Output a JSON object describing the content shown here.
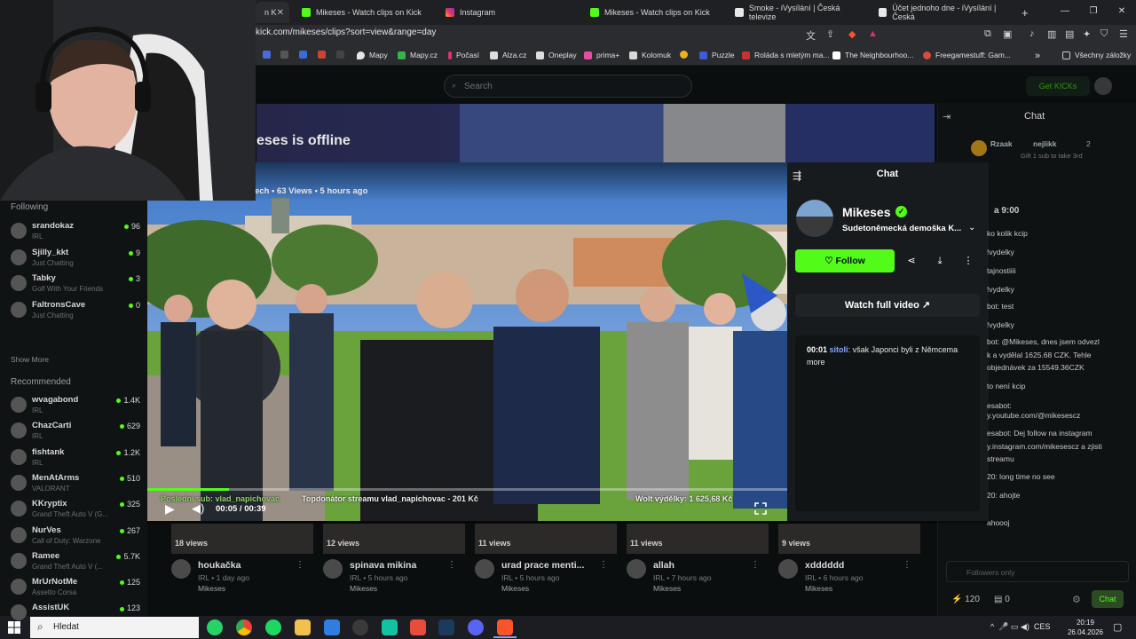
{
  "browser": {
    "tabs": [
      {
        "label": "n K",
        "active": true
      },
      {
        "label": "Mikeses - Watch clips on Kick"
      },
      {
        "label": "Instagram"
      },
      {
        "label": "Mikeses - Watch clips on Kick"
      },
      {
        "label": "Smoke - iVysílání | Česká televize"
      },
      {
        "label": "Účet jednoho dne - iVysílání | Česká"
      }
    ],
    "new_tab": "+",
    "url": "kick.com/mikeses/clips?sort=view&range=day",
    "bookmarks": [
      "Mapy",
      "Mapy.cz",
      "Počasí",
      "Alza.cz",
      "Oneplay",
      "prima+",
      "Kolomuk",
      "Puzzle",
      "Roláda s mletým ma...",
      "The Neighbourhoo...",
      "Freegamestuff: Gam...",
      "Všechny záložky"
    ],
    "bookmarks_more": "»"
  },
  "kick": {
    "search_placeholder": "Search",
    "get_kicks": "Get KICKs",
    "offline_text": "eses is offline",
    "sidebar": {
      "following_heading": "Following",
      "following": [
        {
          "name": "srandokaz",
          "category": "IRL",
          "viewers": "96"
        },
        {
          "name": "Sjilly_kkt",
          "category": "Just Chatting",
          "viewers": "9"
        },
        {
          "name": "Tabky",
          "category": "Golf With Your Friends",
          "viewers": "3"
        },
        {
          "name": "FaltronsCave",
          "category": "Just Chatting",
          "viewers": "0"
        }
      ],
      "show_more": "Show More",
      "recommended_heading": "Recommended",
      "recommended": [
        {
          "name": "wvagabond",
          "category": "IRL",
          "viewers": "1.4K"
        },
        {
          "name": "ChazCarti",
          "category": "IRL",
          "viewers": "629"
        },
        {
          "name": "fishtank",
          "category": "IRL",
          "viewers": "1.2K"
        },
        {
          "name": "MenAtArms",
          "category": "VALORANT",
          "viewers": "510"
        },
        {
          "name": "KKryptix",
          "category": "Grand Theft Auto V (G...",
          "viewers": "325"
        },
        {
          "name": "NurVes",
          "category": "Call of Duty: Warzone",
          "viewers": "267"
        },
        {
          "name": "Ramee",
          "category": "Grand Theft Auto V (...",
          "viewers": "5.7K"
        },
        {
          "name": "MrUrNotMe",
          "category": "Assetto Corsa",
          "viewers": "125"
        },
        {
          "name": "AssistUK",
          "category": "",
          "viewers": "123"
        }
      ]
    },
    "side_chat": {
      "title": "Chat",
      "pinned_user": "Rzaak",
      "pinned_other": "nejlikk",
      "pinned_count": "2",
      "pinned_note": "Gift 1 sub to take 3rd",
      "time_label": "a 9:00",
      "lines": [
        "ko kolik kcip",
        "!vydelky",
        "tajnostiiii",
        "!vydelky",
        "bot: test",
        "!vydelky",
        "bot: @Mikeses, dnes jsem odvezl",
        "k a vydělal 1625.68 CZK. Tehle",
        "objednávek za 15549.36CZK",
        "to není kcip",
        "esabot:",
        "y.youtube.com/@mikesescz",
        "esabot: Dej follow na instagram",
        "y.instagram.com/mikesescz a zjisti",
        "streamu",
        "20: long time no see",
        "20: ahojte",
        "ahoooj"
      ],
      "input_placeholder": "Followers only",
      "kicks_count": "120",
      "slots_count": "0",
      "send_label": "Chat"
    },
    "clips": [
      {
        "views": "18 views",
        "title": "houkačka",
        "meta": "IRL • 1 day ago",
        "channel": "Mikeses"
      },
      {
        "views": "12 views",
        "title": "spinava mikina",
        "meta": "IRL • 5 hours ago",
        "channel": "Mikeses"
      },
      {
        "views": "11 views",
        "title": "urad prace menti...",
        "meta": "IRL • 5 hours ago",
        "channel": "Mikeses"
      },
      {
        "views": "11 views",
        "title": "allah",
        "meta": "IRL • 7 hours ago",
        "channel": "Mikeses"
      },
      {
        "views": "9 views",
        "title": "xdddddd",
        "meta": "IRL • 6 hours ago",
        "channel": "Mikeses"
      }
    ]
  },
  "modal": {
    "video_meta": "ech • 63 Views • 5 hours ago",
    "overlay_left": "Poslední sub: vlad_napichovac",
    "overlay_mid": "Topdonátor streamu vlad_napichovac - 201 Kč",
    "overlay_right": "Wolt výdělky: 1 625,68 Kč",
    "time": "00:05 / 00:39",
    "progress_fraction": 0.128,
    "panel_title": "Chat",
    "channel_name": "Mikeses",
    "clip_title": "Sudetoněmecká demoška K...",
    "follow_label": "Follow",
    "watch_full": "Watch full video",
    "chat_message": {
      "time": "00:01",
      "user": "sitoli",
      "text": ": však Japonci byli z Němcema",
      "more": "more"
    }
  },
  "taskbar": {
    "search_placeholder": "Hledat",
    "tray_lang": "CES",
    "clock_time": "20:19",
    "clock_date": "26.04.2026"
  },
  "colors": {
    "kick_green": "#53fc18",
    "page_bg": "#0b0e0f",
    "panel_bg": "#181b1d"
  }
}
